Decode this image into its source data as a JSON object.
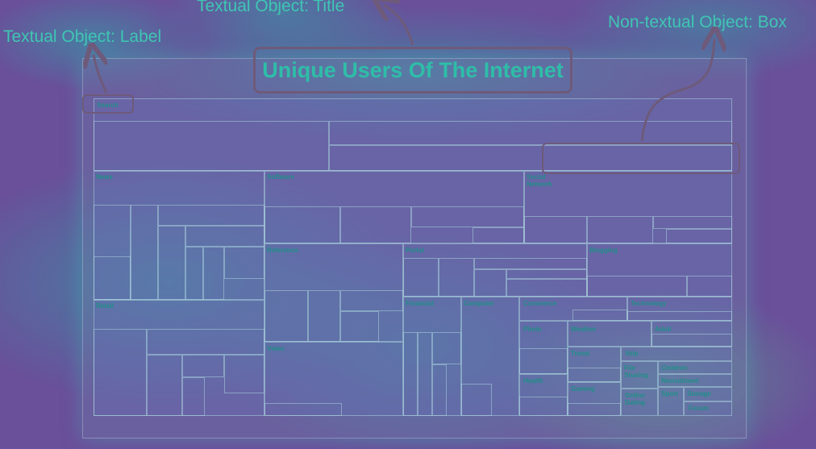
{
  "annotations": {
    "title_label": "Textual Object: Title",
    "label_label": "Textual Object: Label",
    "box_label": "Non-textual Object: Box"
  },
  "chart": {
    "title": "Unique Users Of The Internet",
    "categories": {
      "search": "Search",
      "news": "News",
      "software": "Software",
      "social_network": "Social Network",
      "reference": "Reference",
      "portal": "Portal",
      "blogging": "Blogging",
      "retail": "Retail",
      "financial": "Financial",
      "computer": "Computer",
      "commerce": "Commerce",
      "technology": "Technology",
      "photo": "Photo",
      "weather": "Weather",
      "adult": "Adult",
      "video": "Video",
      "travel": "Travel",
      "voip": "Voip",
      "file_sharing": "File Sharing",
      "children": "Children",
      "recruitment": "Recruitment",
      "health": "Health",
      "gaming": "Gaming",
      "online_dating": "Online Dating",
      "sport": "Sport",
      "storage": "Storage",
      "forum": "Forum"
    }
  }
}
